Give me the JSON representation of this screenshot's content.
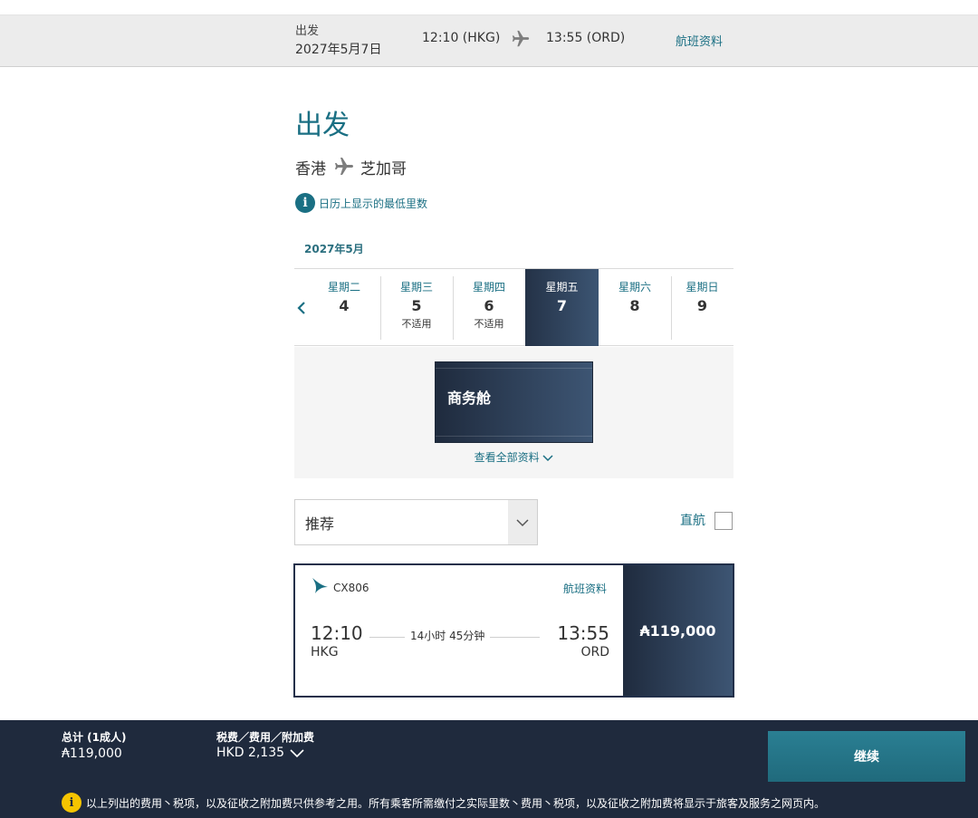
{
  "summary": {
    "departure_label": "出发",
    "departure_date": "2027年5月7日",
    "depart_time": "12:10 (HKG)",
    "arrive_time": "13:55 (ORD)",
    "flight_info_link": "航班资料"
  },
  "page": {
    "title": "出发",
    "origin": "香港",
    "destination": "芝加哥",
    "calendar_note": "日历上显示的最低里数"
  },
  "calendar": {
    "month": "2027年5月",
    "days": [
      {
        "weekday": "星期二",
        "day": "4",
        "note": ""
      },
      {
        "weekday": "星期三",
        "day": "5",
        "note": "不适用"
      },
      {
        "weekday": "星期四",
        "day": "6",
        "note": "不适用"
      },
      {
        "weekday": "星期五",
        "day": "7",
        "note": "",
        "selected": true
      },
      {
        "weekday": "星期六",
        "day": "8",
        "note": ""
      },
      {
        "weekday": "星期日",
        "day": "9",
        "note": ""
      }
    ]
  },
  "cabin": {
    "label": "商务舱",
    "view_all": "查看全部资料"
  },
  "filters": {
    "sort_value": "推荐",
    "nonstop_label": "直航"
  },
  "flight": {
    "number": "CX806",
    "info_link": "航班资料",
    "depart_time": "12:10",
    "depart_code": "HKG",
    "duration": "14小时 45分钟",
    "arrive_time": "13:55",
    "arrive_code": "ORD",
    "price": "₳119,000"
  },
  "footer": {
    "total_label": "总计 (1成人)",
    "total_value": "₳119,000",
    "tax_label": "税费／费用／附加费",
    "tax_value": "HKD 2,135",
    "continue_label": "继续",
    "notice": "以上列出的费用丶税项，以及征收之附加费只供参考之用。所有乘客所需缴付之实际里数丶费用丶税项，以及征收之附加费将显示于旅客及服务之网页内。"
  },
  "icons": {
    "info": "i",
    "warning": "i"
  },
  "colors": {
    "teal": "#1a6f83",
    "navy": "#1f2a3d",
    "warning": "#f5c400"
  }
}
